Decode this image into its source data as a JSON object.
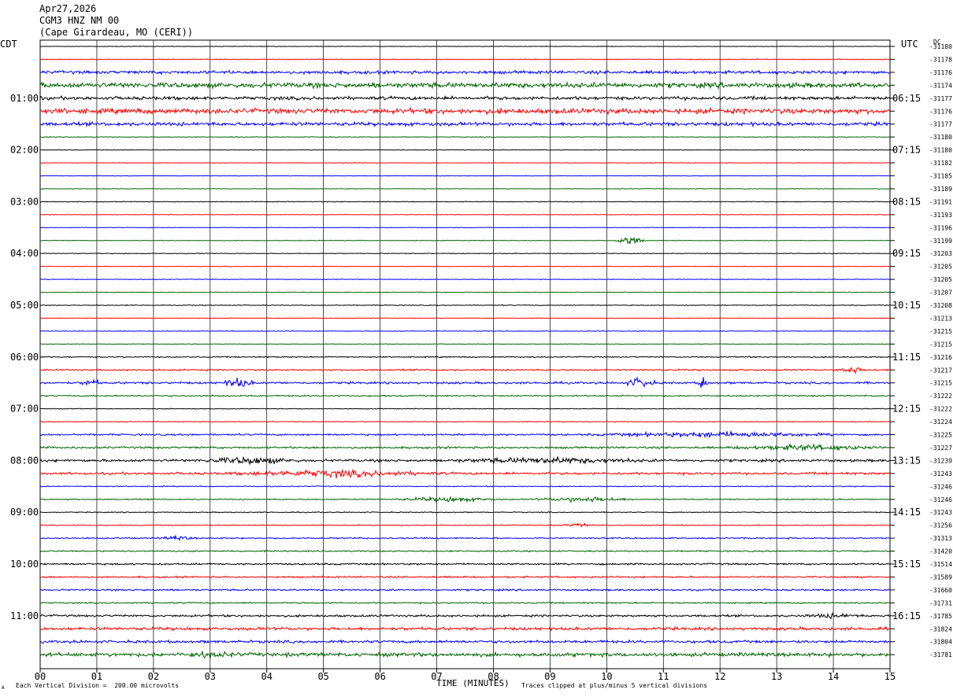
{
  "header": {
    "date": "Apr27,2026",
    "station": "CGM3 HNZ NM 00",
    "location": "(Cape Girardeau, MO (CERI))"
  },
  "left_tz": "CDT",
  "right_tz": "UTC",
  "dc_label": "DC",
  "footer": {
    "xaxis_title": "TIME (MINUTES)",
    "division_note": "Each Vertical Division =  200.00 microvolts",
    "clip_note": "Traces clipped at plus/minus 5 vertical divisions",
    "corner_mark": "A"
  },
  "colors": {
    "cycle": [
      "#000000",
      "#ff0000",
      "#0000ff",
      "#006600"
    ],
    "grid": "#000000",
    "background": "#ffffff"
  },
  "chart_data": {
    "type": "line",
    "title": "CGM3 HNZ NM 00",
    "xlabel": "TIME (MINUTES)",
    "xlim": [
      0,
      15
    ],
    "x_ticks": [
      "00",
      "01",
      "02",
      "03",
      "04",
      "05",
      "06",
      "07",
      "08",
      "09",
      "10",
      "11",
      "12",
      "13",
      "14",
      "15"
    ],
    "grid": true,
    "trace_interval_minutes": 15,
    "left_time_labels": [
      "01:00",
      "02:00",
      "03:00",
      "04:00",
      "05:00",
      "06:00",
      "07:00",
      "08:00",
      "09:00",
      "10:00",
      "11:00"
    ],
    "right_time_labels": [
      "06:15",
      "07:15",
      "08:15",
      "09:15",
      "10:15",
      "11:15",
      "12:15",
      "13:15",
      "14:15",
      "15:15",
      "16:15"
    ],
    "dc_offsets": [
      -31180,
      -31178,
      -31176,
      -31174,
      -31177,
      -31176,
      -31177,
      -31180,
      -31180,
      -31182,
      -31185,
      -31189,
      -31191,
      -31193,
      -31196,
      -31199,
      -31203,
      -31205,
      -31205,
      -31207,
      -31208,
      -31213,
      -31215,
      -31215,
      -31216,
      -31217,
      -31215,
      -31222,
      -31222,
      -31224,
      -31225,
      -31227,
      -31239,
      -31243,
      -31246,
      -31246,
      -31243,
      -31256,
      -31313,
      -31420,
      -31514,
      -31589,
      -31660,
      -31731,
      -31785,
      -31824,
      -31804,
      -31781
    ],
    "noise_levels": [
      0.3,
      0.4,
      1.6,
      2.6,
      1.7,
      2.6,
      1.8,
      0.35,
      0.3,
      0.3,
      0.3,
      0.3,
      0.4,
      0.3,
      0.3,
      0.3,
      0.35,
      0.3,
      0.35,
      0.35,
      0.4,
      0.3,
      0.35,
      0.3,
      0.6,
      0.8,
      1.1,
      0.7,
      0.4,
      0.4,
      0.9,
      1.0,
      1.3,
      1.2,
      0.5,
      0.6,
      0.5,
      0.5,
      0.7,
      0.7,
      0.9,
      0.9,
      0.9,
      0.7,
      1.1,
      1.5,
      1.4,
      1.9
    ],
    "events": [
      {
        "trace": 15,
        "minute": 10.4,
        "amplitude": 9,
        "duration": 0.3
      },
      {
        "trace": 25,
        "minute": 14.3,
        "amplitude": 6,
        "duration": 0.3
      },
      {
        "trace": 26,
        "minute": 0.9,
        "amplitude": 6,
        "duration": 0.2
      },
      {
        "trace": 26,
        "minute": 3.5,
        "amplitude": 8,
        "duration": 0.3
      },
      {
        "trace": 26,
        "minute": 10.6,
        "amplitude": 9,
        "duration": 0.3
      },
      {
        "trace": 26,
        "minute": 11.7,
        "amplitude": 14,
        "duration": 0.1
      },
      {
        "trace": 30,
        "minute": 12.0,
        "amplitude": 4,
        "duration": 2.5
      },
      {
        "trace": 31,
        "minute": 13.5,
        "amplitude": 4,
        "duration": 1.5
      },
      {
        "trace": 32,
        "minute": 3.7,
        "amplitude": 5,
        "duration": 1.0
      },
      {
        "trace": 32,
        "minute": 9.0,
        "amplitude": 4,
        "duration": 2.0
      },
      {
        "trace": 33,
        "minute": 5.2,
        "amplitude": 5,
        "duration": 2.0
      },
      {
        "trace": 35,
        "minute": 7.2,
        "amplitude": 4,
        "duration": 1.0
      },
      {
        "trace": 35,
        "minute": 9.6,
        "amplitude": 4,
        "duration": 1.0
      },
      {
        "trace": 37,
        "minute": 9.5,
        "amplitude": 3,
        "duration": 0.3
      },
      {
        "trace": 38,
        "minute": 2.4,
        "amplitude": 3,
        "duration": 0.4
      },
      {
        "trace": 44,
        "minute": 14.0,
        "amplitude": 3,
        "duration": 0.6
      },
      {
        "trace": 47,
        "minute": 3.0,
        "amplitude": 3,
        "duration": 0.6
      }
    ]
  }
}
